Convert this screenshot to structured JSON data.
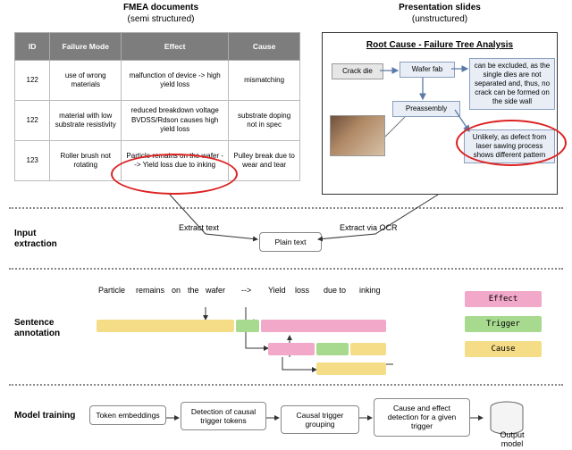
{
  "columns": {
    "left_title": "FMEA documents",
    "left_sub": "(semi structured)",
    "right_title": "Presentation slides",
    "right_sub": "(unstructured)"
  },
  "table": {
    "headers": [
      "ID",
      "Failure Mode",
      "Effect",
      "Cause"
    ],
    "rows": [
      {
        "id": "122",
        "fm": "use of wrong materials",
        "eff": "malfunction of device -> high yield loss",
        "cause": "mismatching"
      },
      {
        "id": "122",
        "fm": "material with low substrate resistivity",
        "eff": "reduced breakdown voltage BVDSS/Rdson causes high yield loss",
        "cause": "substrate doping not in spec"
      },
      {
        "id": "123",
        "fm": "Roller brush not rotating",
        "eff": "Particle remains on the wafer --> Yield loss due to inking",
        "cause": "Pulley break due to wear and tear"
      }
    ]
  },
  "slide": {
    "title": "Root Cause - Failure Tree Analysis",
    "crack": "Crack die",
    "wafer": "Wafer fab",
    "pre": "Preassembly",
    "note1": "can be excluded, as the single dies are not separated and, thus, no crack can be formed on the side wall",
    "note2": "Unlikely, as defect from laser sawing process shows different pattern"
  },
  "stage1": {
    "label": "Input extraction",
    "extract_text": "Extract text",
    "plain": "Plain text",
    "extract_ocr": "Extract via OCR"
  },
  "stage2": {
    "label": "Sentence annotation",
    "tokens": [
      "Particle",
      "remains",
      "on",
      "the",
      "wafer",
      "-->",
      "Yield",
      "loss",
      "due to",
      "inking"
    ],
    "legend": {
      "effect": "Effect",
      "trigger": "Trigger",
      "cause": "Cause"
    }
  },
  "stage3": {
    "label": "Model training",
    "steps": [
      "Token embeddings",
      "Detection of causal trigger tokens",
      "Causal trigger grouping",
      "Cause and effect detection for a given trigger",
      "Output model"
    ]
  }
}
